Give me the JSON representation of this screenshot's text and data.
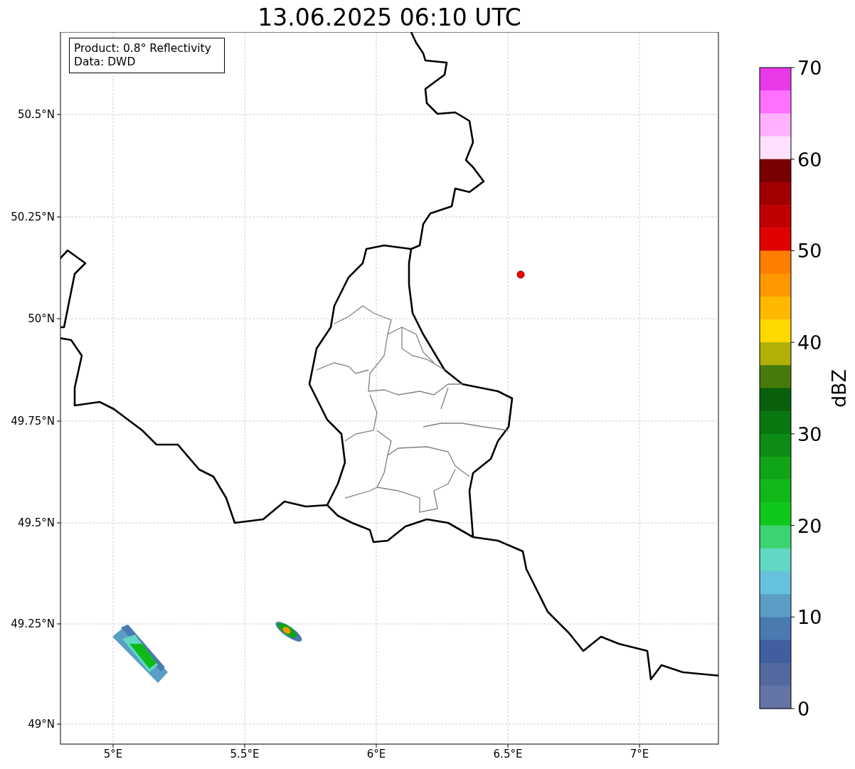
{
  "title": "13.06.2025 06:10 UTC",
  "map": {
    "info": [
      "Product: 0.8° Reflectivity",
      "Data: DWD"
    ],
    "x_ticks": [
      "5°E",
      "5.5°E",
      "6°E",
      "6.5°E",
      "7°E"
    ],
    "y_ticks": [
      "50.5°N",
      "50.25°N",
      "50°N",
      "49.75°N",
      "49.5°N",
      "49.25°N",
      "49°N"
    ]
  },
  "colorbar": {
    "label": "dBZ",
    "ticks": [
      "70",
      "60",
      "50",
      "40",
      "30",
      "20",
      "10",
      "0"
    ],
    "bands": [
      {
        "color": "#e838e8"
      },
      {
        "color": "#ff70ff"
      },
      {
        "color": "#ffb0ff"
      },
      {
        "color": "#ffe0ff"
      },
      {
        "color": "#780000"
      },
      {
        "color": "#a00000"
      },
      {
        "color": "#c00000"
      },
      {
        "color": "#e00000"
      },
      {
        "color": "#ff7e00"
      },
      {
        "color": "#ff9800"
      },
      {
        "color": "#ffb800"
      },
      {
        "color": "#ffd800"
      },
      {
        "color": "#b0b008"
      },
      {
        "color": "#467a0a"
      },
      {
        "color": "#08600c"
      },
      {
        "color": "#0a7810"
      },
      {
        "color": "#0c8c14"
      },
      {
        "color": "#10a418"
      },
      {
        "color": "#10b818"
      },
      {
        "color": "#10c81c"
      },
      {
        "color": "#3cd472"
      },
      {
        "color": "#60d8c4"
      },
      {
        "color": "#66c2dc"
      },
      {
        "color": "#5a9ec6"
      },
      {
        "color": "#4a7ab0"
      },
      {
        "color": "#405ea0"
      },
      {
        "color": "#5468a0"
      },
      {
        "color": "#6474a6"
      }
    ]
  }
}
